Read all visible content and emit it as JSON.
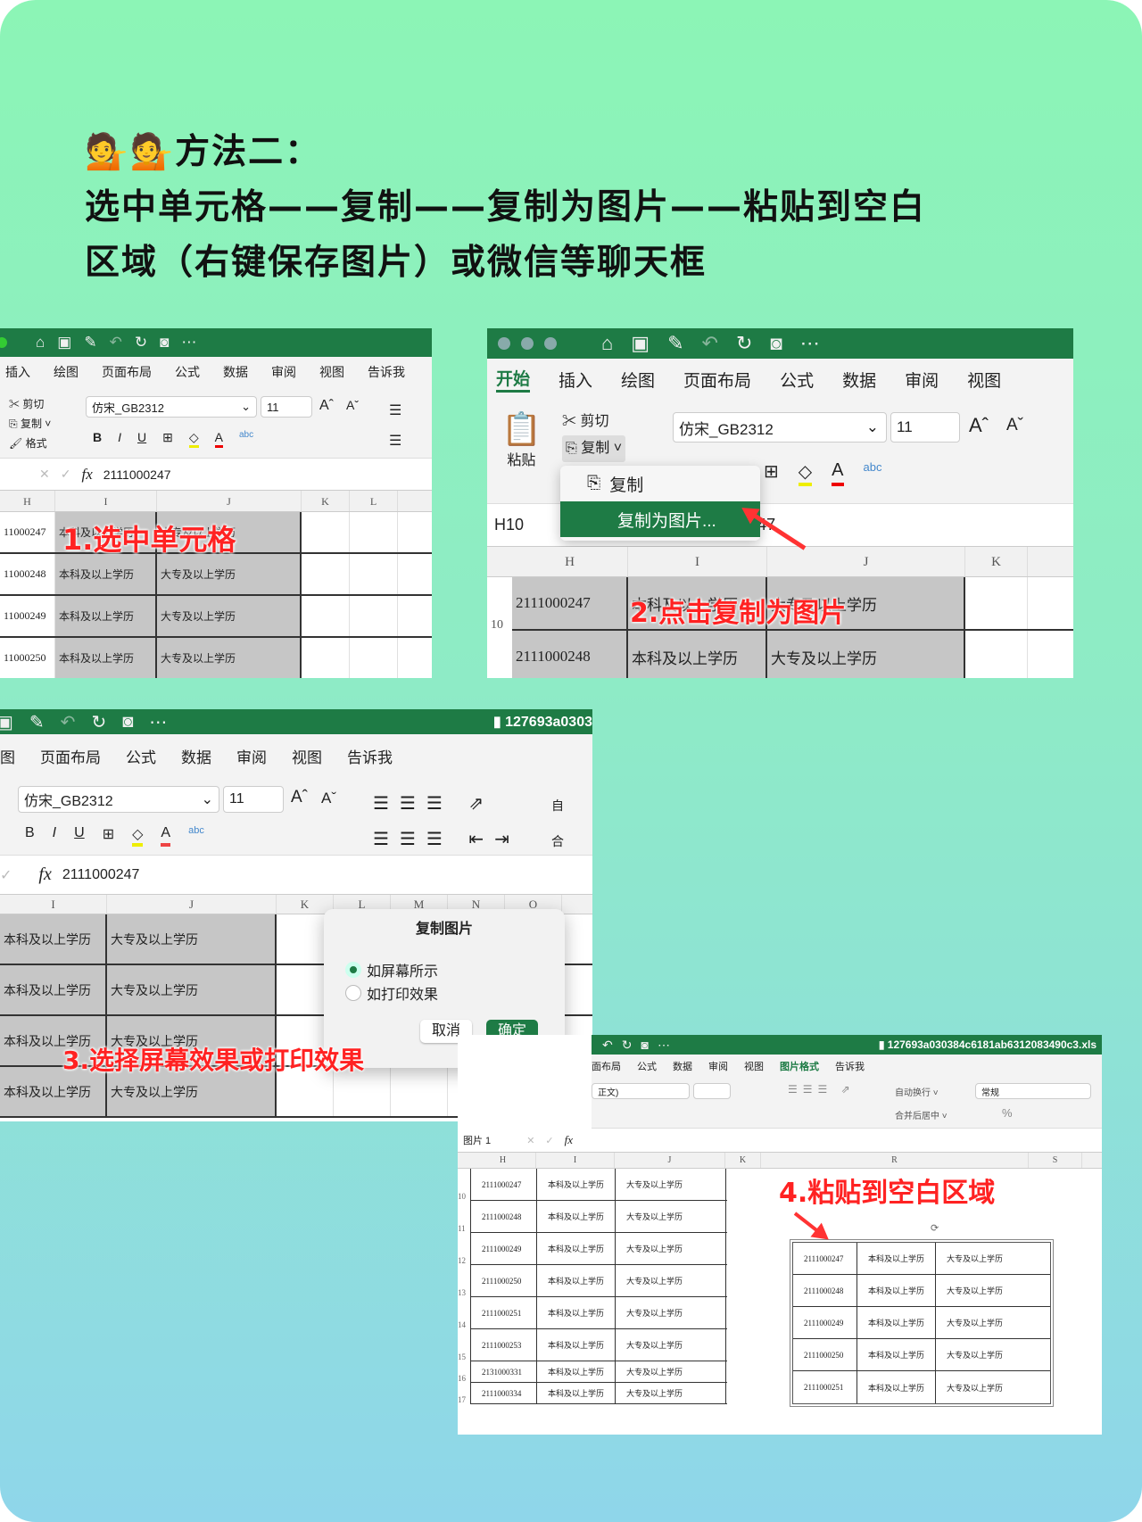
{
  "title": {
    "line1": "💁💁方法二：",
    "line2": "选中单元格——复制——复制为图片——粘贴到空白",
    "line3": "区域（右键保存图片）或微信等聊天框"
  },
  "colors": {
    "excel_green": "#1e7b45",
    "step_red": "#ff2222",
    "selection_gray": "#c6c6c6"
  },
  "toolbar_icons": [
    "home-icon",
    "save-icon",
    "save-as-icon",
    "undo-icon",
    "redo-icon",
    "camera-icon",
    "more-icon"
  ],
  "ribbon": {
    "font": "仿宋_GB2312",
    "size": "11",
    "cut": "剪切",
    "copy": "复制",
    "format": "格式",
    "paste": "粘贴",
    "bold": "B",
    "italic": "I",
    "underline": "U",
    "grow": "A^",
    "shrink": "Aˇ",
    "fontcolor": "A",
    "abc": "abc",
    "wrap": "自动换行",
    "merge": "合并后居中",
    "number_format": "常规",
    "percent": "%",
    "font4": "正文)",
    "wrap3": "自",
    "merge3": "合"
  },
  "formula": {
    "value": "2111000247",
    "fx": "fx",
    "cell_ref": "H10",
    "picture_ref": "图片 1"
  },
  "panel1": {
    "tabs": [
      "插入",
      "绘图",
      "页面布局",
      "公式",
      "数据",
      "审阅",
      "视图",
      "告诉我"
    ],
    "cols": [
      "H",
      "I",
      "J",
      "K",
      "L"
    ],
    "rows": [
      [
        "11000247",
        "本科及以上学历",
        "大专及以上学历"
      ],
      [
        "11000248",
        "本科及以上学历",
        "大专及以上学历"
      ],
      [
        "11000249",
        "本科及以上学历",
        "大专及以上学历"
      ],
      [
        "11000250",
        "本科及以上学历",
        "大专及以上学历"
      ]
    ],
    "step": "1.选中单元格"
  },
  "panel2": {
    "tabs": [
      "开始",
      "插入",
      "绘图",
      "页面布局",
      "公式",
      "数据",
      "审阅",
      "视图"
    ],
    "cols": [
      "H",
      "I",
      "J",
      "K"
    ],
    "row_numbers": [
      "10"
    ],
    "rows": [
      [
        "2111000247",
        "本科及以上学历",
        "大专及以上学历"
      ],
      [
        "2111000248",
        "本科及以上学历",
        "大专及以上学历"
      ]
    ],
    "menu": {
      "copy": "复制",
      "copy_as_picture": "复制为图片..."
    },
    "formula_partial": "1000247",
    "step": "2.点击复制为图片"
  },
  "panel3": {
    "tabs": [
      "图",
      "页面布局",
      "公式",
      "数据",
      "审阅",
      "视图",
      "告诉我"
    ],
    "filename": "127693a0303",
    "cols": [
      "I",
      "J",
      "K",
      "L",
      "M",
      "N",
      "O"
    ],
    "rows": [
      [
        "本科及以上学历",
        "大专及以上学历"
      ],
      [
        "本科及以上学历",
        "大专及以上学历"
      ],
      [
        "本科及以上学历",
        "大专及以上学历"
      ],
      [
        "本科及以上学历",
        "大专及以上学历"
      ]
    ],
    "dialog": {
      "title": "复制图片",
      "opt1": "如屏幕所示",
      "opt2": "如打印效果",
      "selected": "如屏幕所示",
      "cancel": "取消",
      "ok": "确定"
    },
    "step": "3.选择屏幕效果或打印效果"
  },
  "panel4": {
    "tabs": [
      "面布局",
      "公式",
      "数据",
      "审阅",
      "视图",
      "图片格式",
      "告诉我"
    ],
    "active_tab": "图片格式",
    "filename": "127693a030384c6181ab6312083490c3.xls",
    "cols": [
      "H",
      "I",
      "J",
      "K",
      "R",
      "S"
    ],
    "row_numbers": [
      "10",
      "11",
      "12",
      "13",
      "14",
      "15",
      "16",
      "17"
    ],
    "rows": [
      [
        "2111000247",
        "本科及以上学历",
        "大专及以上学历"
      ],
      [
        "2111000248",
        "本科及以上学历",
        "大专及以上学历"
      ],
      [
        "2111000249",
        "本科及以上学历",
        "大专及以上学历"
      ],
      [
        "2111000250",
        "本科及以上学历",
        "大专及以上学历"
      ],
      [
        "2111000251",
        "本科及以上学历",
        "大专及以上学历"
      ],
      [
        "2111000253",
        "本科及以上学历",
        "大专及以上学历"
      ],
      [
        "2131000331",
        "本科及以上学历",
        "大专及以上学历"
      ],
      [
        "2111000334",
        "本科及以上学历",
        "大专及以上学历"
      ]
    ],
    "pasted": [
      [
        "2111000247",
        "本科及以上学历",
        "大专及以上学历"
      ],
      [
        "2111000248",
        "本科及以上学历",
        "大专及以上学历"
      ],
      [
        "2111000249",
        "本科及以上学历",
        "大专及以上学历"
      ],
      [
        "2111000250",
        "本科及以上学历",
        "大专及以上学历"
      ],
      [
        "2111000251",
        "本科及以上学历",
        "大专及以上学历"
      ]
    ],
    "step": "4.粘贴到空白区域"
  }
}
